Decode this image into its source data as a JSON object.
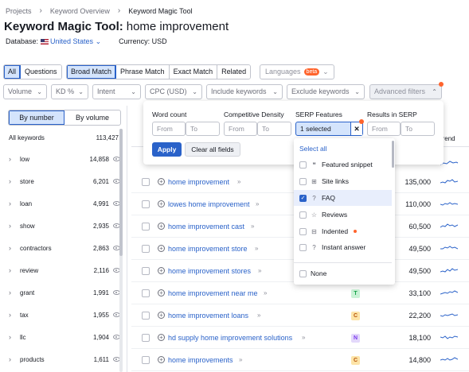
{
  "breadcrumb": [
    "Projects",
    "Keyword Overview",
    "Keyword Magic Tool"
  ],
  "title": {
    "tool": "Keyword Magic Tool:",
    "query": "home improvement"
  },
  "database": {
    "label": "Database:",
    "value": "United States",
    "currency": "Currency: USD"
  },
  "match_tabs": {
    "all": "All",
    "questions": "Questions",
    "broad": "Broad Match",
    "phrase": "Phrase Match",
    "exact": "Exact Match",
    "related": "Related"
  },
  "languages": {
    "label": "Languages",
    "badge": "beta"
  },
  "filters": {
    "volume": "Volume",
    "kd": "KD %",
    "intent": "Intent",
    "cpc": "CPC (USD)",
    "include": "Include keywords",
    "exclude": "Exclude keywords",
    "advanced": "Advanced filters"
  },
  "sidebar": {
    "by_number": "By number",
    "by_volume": "By volume",
    "all_keywords_label": "All keywords",
    "all_keywords_count": "113,427",
    "items": [
      {
        "label": "low",
        "count": "14,858"
      },
      {
        "label": "store",
        "count": "6,201"
      },
      {
        "label": "loan",
        "count": "4,991"
      },
      {
        "label": "show",
        "count": "2,935"
      },
      {
        "label": "contractors",
        "count": "2,863"
      },
      {
        "label": "review",
        "count": "2,116"
      },
      {
        "label": "grant",
        "count": "1,991"
      },
      {
        "label": "tax",
        "count": "1,955"
      },
      {
        "label": "llc",
        "count": "1,904"
      },
      {
        "label": "products",
        "count": "1,611"
      }
    ]
  },
  "table": {
    "col_all": "A",
    "col_trend": "Trend",
    "rows": [
      {
        "keyword": "home improvement",
        "intent": "",
        "volume": "135,000"
      },
      {
        "keyword": "lowes home improvement",
        "intent": "",
        "volume": "110,000"
      },
      {
        "keyword": "home improvement cast",
        "intent": "",
        "volume": "60,500"
      },
      {
        "keyword": "home improvement store",
        "intent": "",
        "volume": "49,500"
      },
      {
        "keyword": "home improvement stores",
        "intent": "",
        "volume": "49,500"
      },
      {
        "keyword": "home improvement near me",
        "intent": "T",
        "volume": "33,100"
      },
      {
        "keyword": "home improvement loans",
        "intent": "C",
        "volume": "22,200"
      },
      {
        "keyword": "hd supply home improvement solutions",
        "intent": "N",
        "volume": "18,100"
      },
      {
        "keyword": "home improvements",
        "intent": "C",
        "volume": "14,800"
      }
    ]
  },
  "filter_popup": {
    "word_count": "Word count",
    "competitive_density": "Competitive Density",
    "serp_features": "SERP Features",
    "results_in_serp": "Results in SERP",
    "from": "From",
    "to": "To",
    "serp_selected": "1 selected",
    "apply": "Apply",
    "clear": "Clear all fields"
  },
  "serp_dropdown": {
    "select_all": "Select all",
    "options": [
      {
        "label": "Featured snippet",
        "checked": false,
        "icon": "quote-icon"
      },
      {
        "label": "Site links",
        "checked": false,
        "icon": "link-icon"
      },
      {
        "label": "FAQ",
        "checked": true,
        "icon": "question-icon"
      },
      {
        "label": "Reviews",
        "checked": false,
        "icon": "star-icon"
      },
      {
        "label": "Indented",
        "checked": false,
        "icon": "indent-icon"
      },
      {
        "label": "Instant answer",
        "checked": false,
        "icon": "answer-icon"
      }
    ],
    "none": "None"
  },
  "colors": {
    "accent": "#2a62c9",
    "selected_bg": "#d4e4fc",
    "orange": "#ff642d"
  }
}
